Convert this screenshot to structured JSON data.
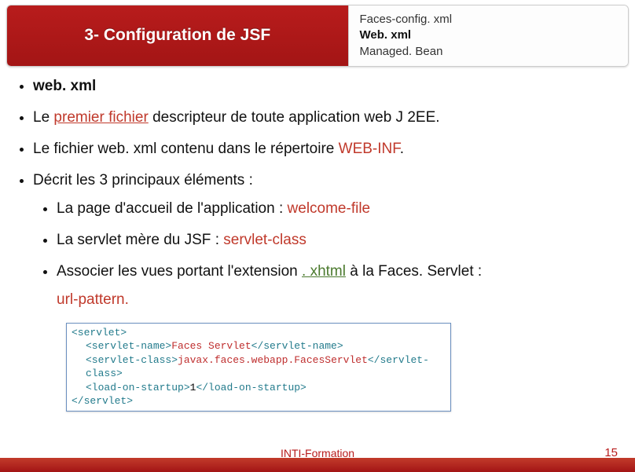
{
  "header": {
    "title": "3- Configuration de JSF",
    "right": {
      "line1": "Faces-config. xml",
      "line2": "Web. xml",
      "line3": "Managed. Bean"
    }
  },
  "bullets": {
    "b1": "web. xml",
    "b2a": "Le ",
    "b2b": "premier fichier",
    "b2c": " descripteur de toute application web J 2EE.",
    "b3a": "Le fichier web. xml contenu dans le répertoire ",
    "b3b": "WEB-INF",
    "b3c": ".",
    "b4": "Décrit les 3 principaux éléments :",
    "s1a": "La page d'accueil de l'application : ",
    "s1b": "welcome-file",
    "s2a": "La servlet mère du JSF : ",
    "s2b": "servlet-class",
    "s3a": "Associer les vues portant l'extension ",
    "s3b": ". xhtml",
    "s3c": " à la Faces. Servlet : ",
    "s3d": "url-pattern.",
    "s3d_leading": ""
  },
  "snippet": {
    "l1a": "<servlet>",
    "l2a": "<servlet-name>",
    "l2b": "Faces Servlet",
    "l2c": "</servlet-name>",
    "l3a": "<servlet-class>",
    "l3b": "javax.faces.webapp.FacesServlet",
    "l3c": "</servlet-class>",
    "l4a": "<load-on-startup>",
    "l4b": "1",
    "l4c": "</load-on-startup>",
    "l5a": "</servlet>"
  },
  "footer": {
    "center": "INTI-Formation",
    "page": "15"
  }
}
